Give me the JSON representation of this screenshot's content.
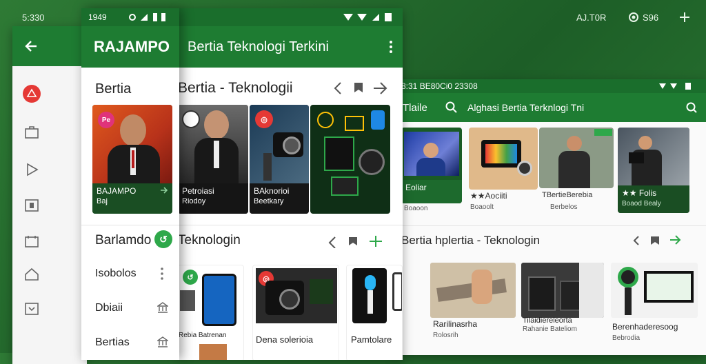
{
  "bg_status": {
    "time": "5:330",
    "right_text": "AJ.T0R",
    "right_icon_text": "S96"
  },
  "panel_a": {
    "nav_icons": [
      "back-arrow-icon",
      "tag-icon",
      "briefcase-icon",
      "play-icon",
      "image-icon",
      "calendar-icon",
      "home-icon",
      "box-icon"
    ]
  },
  "panel_b": {
    "status_time": "1949",
    "brand": "RAJAMPO",
    "section_title": "Bertia",
    "card": {
      "badge": "Pe",
      "title": "BAJAMPO",
      "sub": "Baj"
    },
    "menu": [
      {
        "label": "Barlamdo"
      },
      {
        "label": "Isobolos"
      },
      {
        "label": "Dbiaii"
      },
      {
        "label": "Bertias"
      }
    ]
  },
  "panel_c": {
    "title": "Bertia Teknologi Terkini",
    "section1": "Bertia - Teknologii",
    "cards": [
      {
        "title": "Petroiasi",
        "sub": "Riodoy"
      },
      {
        "title": "BAknorioi",
        "sub": "Beetkary"
      }
    ],
    "section2": "Teknologin",
    "items": [
      {
        "title": "",
        "sub": ""
      },
      {
        "title": "Dena solerioia",
        "sub": ""
      },
      {
        "title": "Pamtolare",
        "sub": ""
      }
    ],
    "item_captions": [
      "Rebia Batrenan"
    ]
  },
  "panel_d": {
    "status_time": "8:31 BE80Ci0 23308",
    "tab": "Tlaile",
    "search_text": "Alghasi Bertia Terknlogi Tni",
    "cards": [
      {
        "title": "Eoliar",
        "sub": "Boaoon"
      },
      {
        "title": "★★Aociiti",
        "sub": "Boaoolt"
      },
      {
        "title": "TBertieBerebia",
        "sub": "Berbelos"
      },
      {
        "title": "★★ Folis",
        "sub": "Boaod Bealy"
      }
    ],
    "section": "Bertia hplertia - Teknologin",
    "items": [
      {
        "title": "Rarilinasrha",
        "sub": "Rolosrih"
      },
      {
        "title": "Tilaidiereleorta",
        "sub": "Rahanie Bateliom"
      },
      {
        "title": "Berenhaderesoog",
        "sub": "Bebrodia"
      }
    ]
  },
  "colors": {
    "green": "#1e7c32",
    "green_dark": "#1a4e23",
    "accent": "#2ea84a",
    "red": "#e53935"
  }
}
